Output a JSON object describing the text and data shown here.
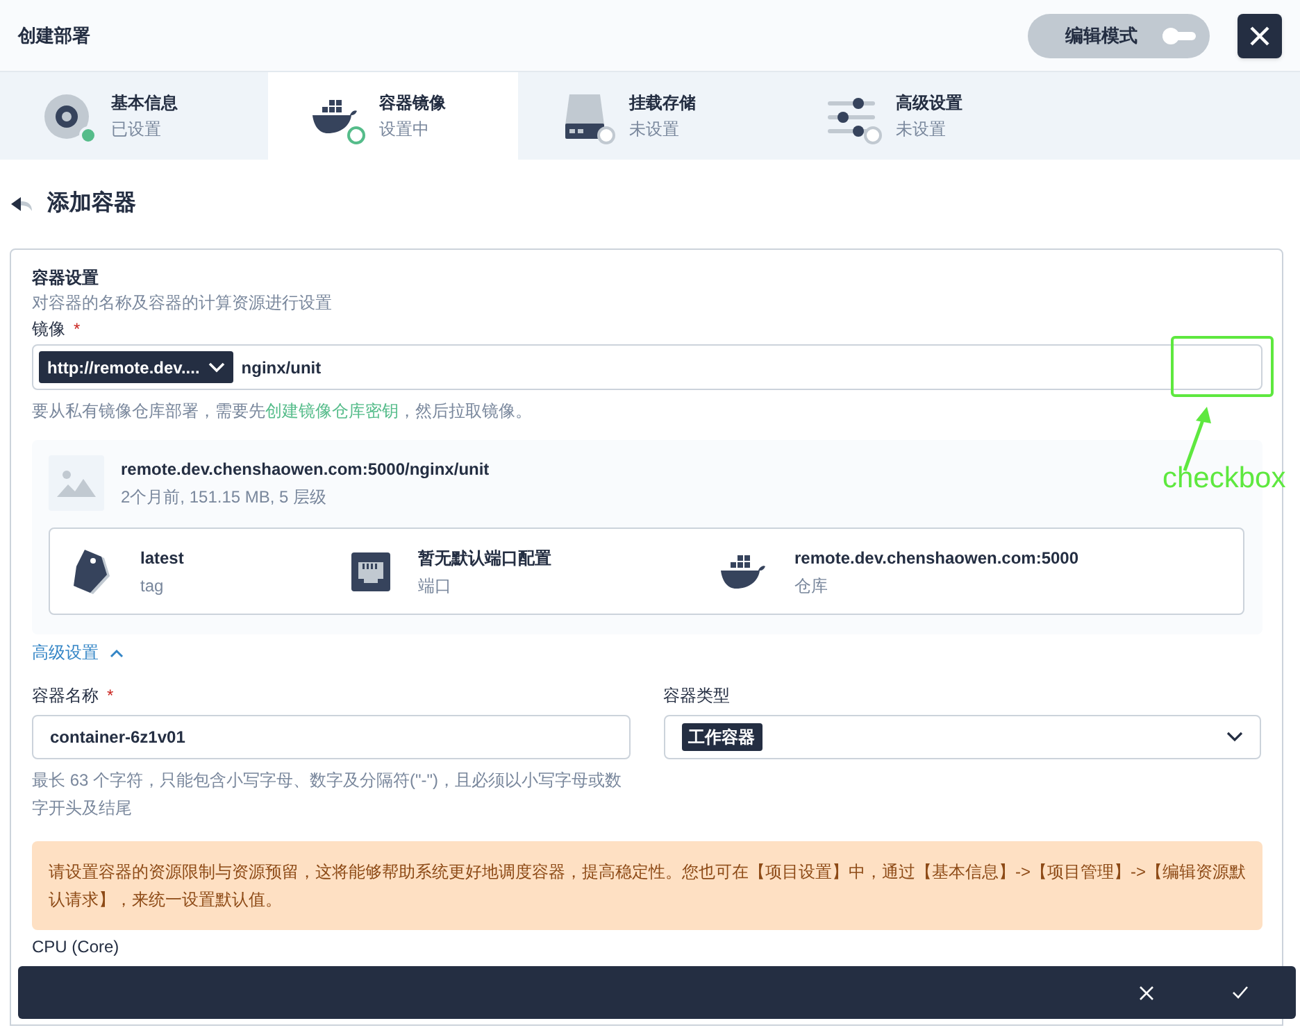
{
  "header": {
    "title": "创建部署",
    "edit_mode": {
      "label": "编辑模式",
      "on": false
    }
  },
  "steps": [
    {
      "title": "基本信息",
      "status": "已设置",
      "kind": "disc",
      "done": true,
      "selected": false
    },
    {
      "title": "容器镜像",
      "status": "设置中",
      "kind": "whale",
      "done": false,
      "selected": true
    },
    {
      "title": "挂载存储",
      "status": "未设置",
      "kind": "drive",
      "done": false,
      "selected": false
    },
    {
      "title": "高级设置",
      "status": "未设置",
      "kind": "sliders",
      "done": false,
      "selected": false
    }
  ],
  "page_title": "添加容器",
  "section": {
    "title": "容器设置",
    "description": "对容器的名称及容器的计算资源进行设置"
  },
  "image_field": {
    "label": "镜像",
    "required_mark": "*",
    "registry": "http://remote.dev....",
    "value": "nginx/unit"
  },
  "image_hint": {
    "before": "要从私有镜像仓库部署，需要先",
    "link": "创建镜像仓库密钥",
    "after": "，然后拉取镜像。"
  },
  "image_info": {
    "name": "remote.dev.chenshaowen.com:5000/nginx/unit",
    "meta": "2个月前, 151.15 MB, 5 层级",
    "items": [
      {
        "kind": "tag",
        "value": "latest",
        "label": "tag"
      },
      {
        "kind": "port",
        "value": "暂无默认端口配置",
        "label": "端口"
      },
      {
        "kind": "whale",
        "value": "remote.dev.chenshaowen.com:5000",
        "label": "仓库"
      }
    ]
  },
  "advanced_toggle": {
    "label": "高级设置",
    "expanded": true
  },
  "container_name": {
    "label": "容器名称",
    "required_mark": "*",
    "value": "container-6z1v01",
    "hint": "最长 63 个字符，只能包含小写字母、数字及分隔符(\"-\")，且必须以小写字母或数字开头及结尾"
  },
  "container_type": {
    "label": "容器类型",
    "value": "工作容器"
  },
  "alert": "请设置容器的资源限制与资源预留，这将能够帮助系统更好地调度容器，提高稳定性。您也可在【项目设置】中，通过【基本信息】->【项目管理】->【编辑资源默认请求】，来统一设置默认值。",
  "cpu_label": "CPU (Core)",
  "annotation": {
    "label": "checkbox"
  }
}
